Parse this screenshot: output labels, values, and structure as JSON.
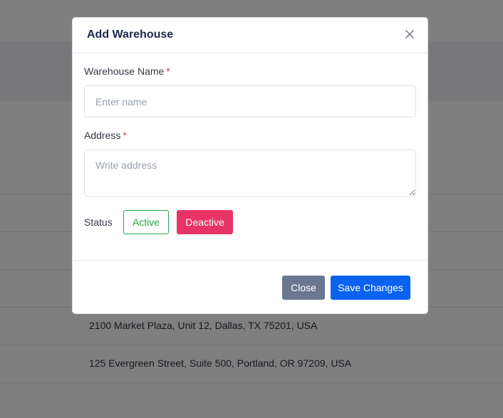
{
  "background": {
    "rows": [
      {
        "address": ""
      },
      {
        "address": ""
      },
      {
        "address": ""
      },
      {
        "address": "2100 Market Plaza, Unit 12, Dallas, TX 75201, USA"
      },
      {
        "address": "125 Evergreen Street, Suite 500, Portland, OR 97209, USA"
      }
    ]
  },
  "modal": {
    "title": "Add Warehouse",
    "close_icon": "close-icon",
    "fields": {
      "name": {
        "label": "Warehouse Name",
        "required_mark": "*",
        "value": "",
        "placeholder": "Enter name"
      },
      "address": {
        "label": "Address",
        "required_mark": "*",
        "value": "",
        "placeholder": "Write address"
      }
    },
    "status": {
      "label": "Status",
      "active_label": "Active",
      "deactive_label": "Deactive"
    },
    "footer": {
      "close_label": "Close",
      "save_label": "Save Changes"
    }
  },
  "colors": {
    "title": "#1b2a4b",
    "required": "#e0325a",
    "active": "#28a745",
    "deactive": "#e83464",
    "close_button": "#6b7690",
    "save_button": "#0b62f0",
    "overlay": "rgba(0,0,0,0.5)"
  }
}
